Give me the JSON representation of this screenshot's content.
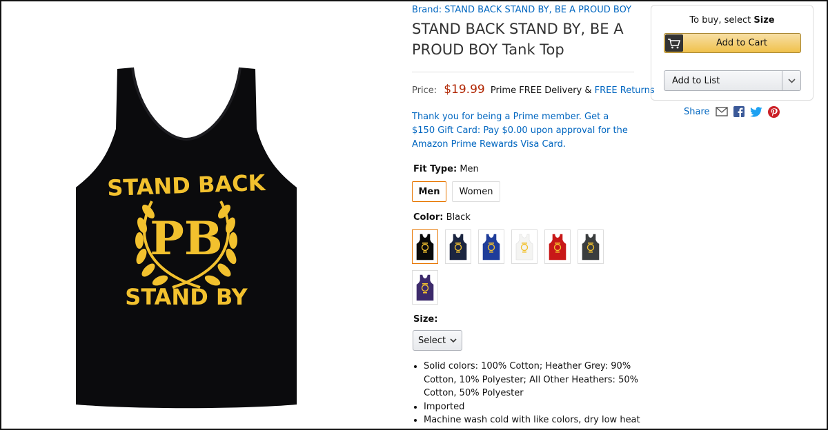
{
  "brand": {
    "label": "Brand: STAND BACK STAND BY, BE A PROUD BOY"
  },
  "title": "STAND BACK STAND BY, BE A PROUD BOY Tank Top",
  "image_text": {
    "line1": "STAND BACK",
    "monogram": "PB",
    "line2": "STAND BY"
  },
  "price": {
    "label": "Price:",
    "value": "$19.99",
    "prime_text": "Prime FREE Delivery &",
    "free_returns": "FREE Returns"
  },
  "promo": "Thank you for being a Prime member. Get a $150 Gift Card: Pay $0.00 upon approval for the Amazon Prime Rewards Visa Card.",
  "fit": {
    "label": "Fit Type:",
    "selected": "Men",
    "options": [
      "Men",
      "Women"
    ]
  },
  "color": {
    "label": "Color:",
    "selected": "Black",
    "swatches": [
      {
        "name": "Black",
        "shirt": "#0a0a0a",
        "print": "#f2c12e"
      },
      {
        "name": "Navy",
        "shirt": "#1b2540",
        "print": "#f2c12e"
      },
      {
        "name": "Royal Blue",
        "shirt": "#1f3d9a",
        "print": "#f2c12e"
      },
      {
        "name": "White",
        "shirt": "#f4f4f2",
        "print": "#f2c12e"
      },
      {
        "name": "Red",
        "shirt": "#c81818",
        "print": "#f2c12e"
      },
      {
        "name": "Asphalt",
        "shirt": "#3a3d3e",
        "print": "#f2c12e"
      },
      {
        "name": "Purple",
        "shirt": "#3c2a6b",
        "print": "#f2c12e"
      }
    ]
  },
  "size": {
    "label": "Size:",
    "select_label": "Select"
  },
  "bullets": [
    "Solid colors: 100% Cotton; Heather Grey: 90% Cotton, 10% Polyester; All Other Heathers: 50% Cotton, 50% Polyester",
    "Imported",
    "Machine wash cold with like colors, dry low heat"
  ],
  "buybox": {
    "prompt_prefix": "To buy, select",
    "prompt_bold": "Size",
    "add_to_cart": "Add to Cart",
    "add_to_list": "Add to List"
  },
  "share": {
    "label": "Share"
  },
  "colors": {
    "link": "#0066c0",
    "price": "#B12704",
    "cart_button": "#f0c14b",
    "selected_border": "#e77600",
    "shirt_print": "#f2c12e"
  },
  "icons": [
    "cart-icon",
    "chevron-down-icon",
    "email-icon",
    "facebook-icon",
    "twitter-icon",
    "pinterest-icon"
  ]
}
